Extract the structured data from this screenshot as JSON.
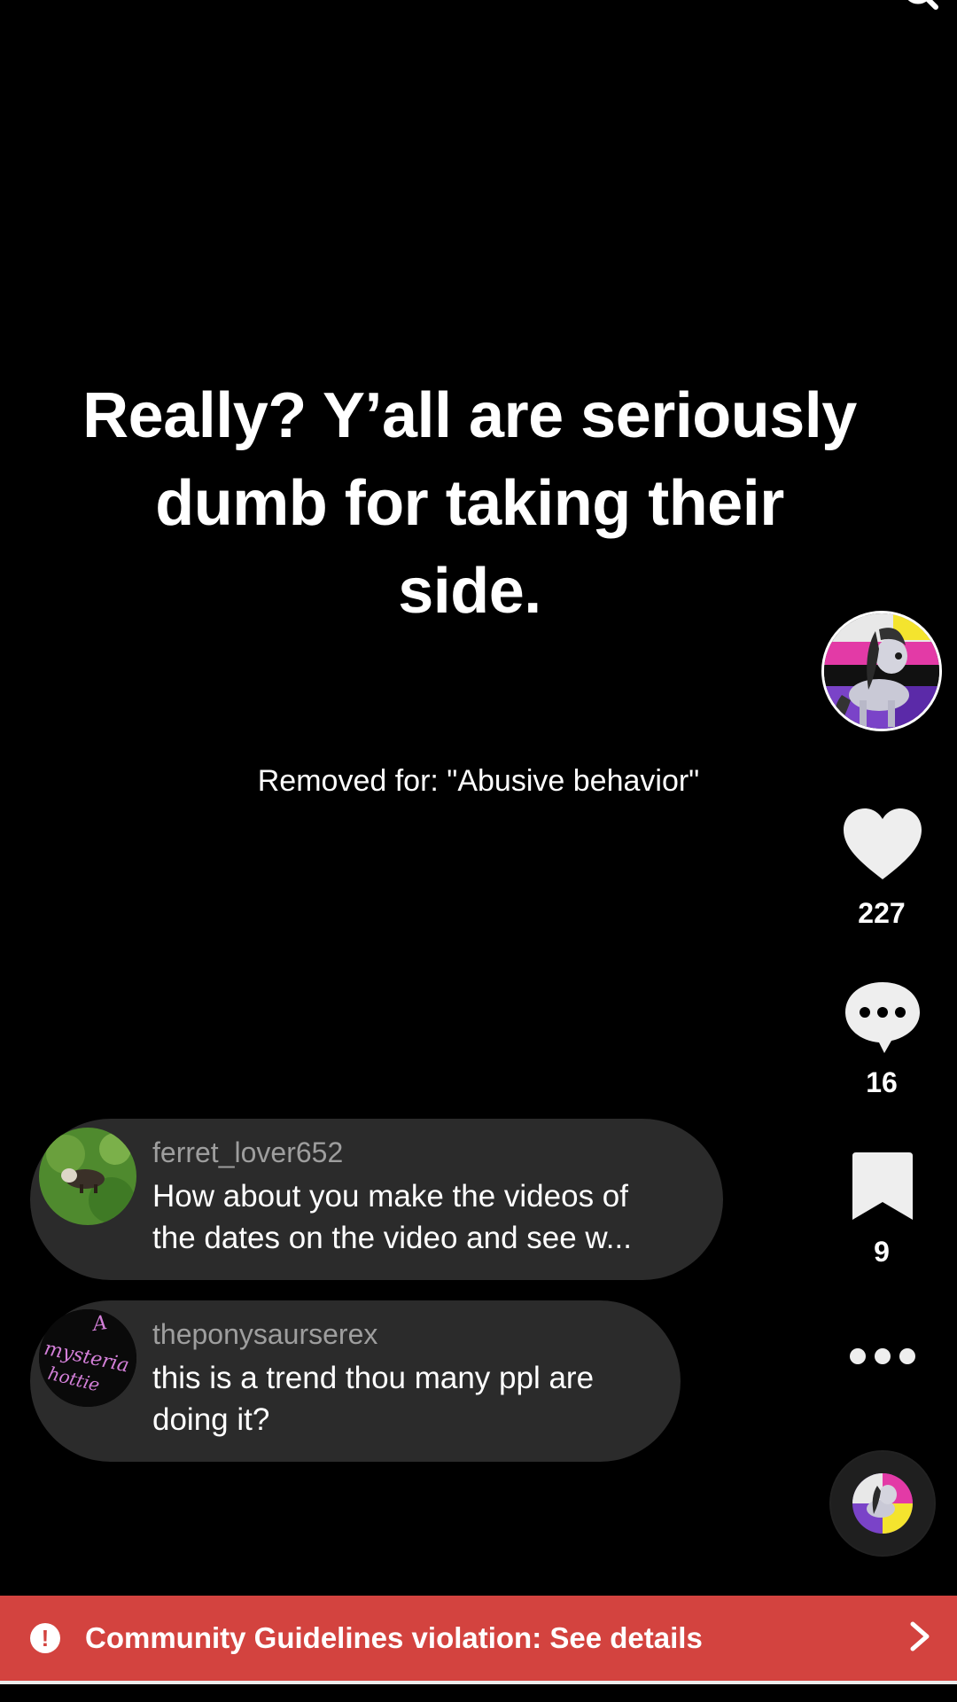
{
  "video": {
    "headline_lines": [
      "Really? Y’all are seriously",
      "dumb for taking their",
      "side."
    ],
    "removed_reason": "Removed for: \"Abusive behavior\""
  },
  "rail": {
    "likes": "227",
    "comments": "16",
    "saves": "9"
  },
  "comments": [
    {
      "user": "ferret_lover652",
      "text_lines": [
        "How about you make the videos of",
        "the dates on the video and see w..."
      ]
    },
    {
      "user": "theponysaurserex",
      "text_lines": [
        "this is a trend thou many ppl are",
        "doing it?"
      ],
      "avatar_scrawl": [
        "A",
        "mysteria",
        "hottie"
      ]
    }
  ],
  "banner": {
    "text": "Community Guidelines violation: See details",
    "color": "#d3433f"
  },
  "icons": {
    "search": "search-icon",
    "heart": "heart-icon",
    "comment": "comment-icon",
    "bookmark": "bookmark-icon",
    "more": "more-icon",
    "warning": "warning-icon",
    "chevron": "chevron-right-icon"
  }
}
